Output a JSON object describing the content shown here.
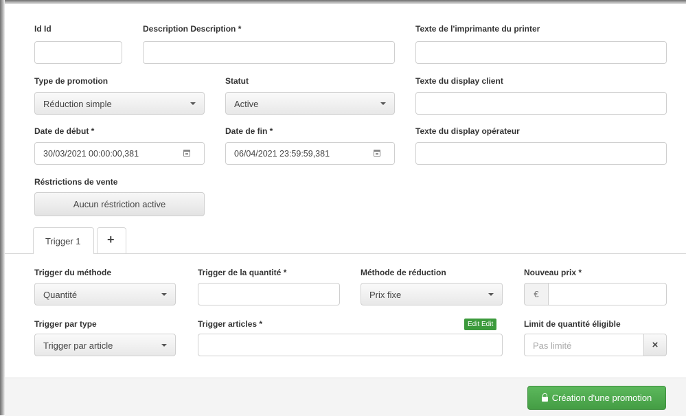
{
  "form": {
    "id": {
      "label": "Id Id",
      "value": ""
    },
    "description": {
      "label": "Description Description *",
      "value": ""
    },
    "printer_text": {
      "label": "Texte de l'imprimante du printer",
      "value": ""
    },
    "promotion_type": {
      "label": "Type de promotion",
      "selected": "Réduction simple"
    },
    "status": {
      "label": "Statut",
      "selected": "Active"
    },
    "client_display": {
      "label": "Texte du display client",
      "value": ""
    },
    "start_date": {
      "label": "Date de début *",
      "value": "30/03/2021 00:00:00,381"
    },
    "end_date": {
      "label": "Date de fin *",
      "value": "06/04/2021 23:59:59,381"
    },
    "operator_display": {
      "label": "Texte du display opérateur",
      "value": ""
    },
    "sales_restrictions": {
      "label": "Réstrictions de vente",
      "button": "Aucun réstriction active"
    }
  },
  "tabs": [
    {
      "label": "Trigger 1"
    },
    {
      "label": "+"
    }
  ],
  "trigger": {
    "method": {
      "label": "Trigger du méthode",
      "selected": "Quantité"
    },
    "quantity": {
      "label": "Trigger de la quantité *",
      "value": ""
    },
    "reduction_method": {
      "label": "Méthode de réduction",
      "selected": "Prix fixe"
    },
    "new_price": {
      "label": "Nouveau prix *",
      "currency": "€",
      "value": ""
    },
    "by_type": {
      "label": "Trigger par type",
      "selected": "Trigger par article"
    },
    "articles": {
      "label": "Trigger articles *",
      "edit_label": "Edit Edit",
      "value": ""
    },
    "eligible_limit": {
      "label": "Limit de quantité éligible",
      "placeholder": "Pas limité",
      "clear": "×"
    }
  },
  "footer": {
    "create_button": "Création d'une promotion"
  },
  "colors": {
    "accent_green": "#449d44",
    "edit_badge": "#3c9a3c"
  },
  "icons": [
    "calendar-icon",
    "chevron-down-icon",
    "lock-icon",
    "plus-icon",
    "close-icon"
  ]
}
